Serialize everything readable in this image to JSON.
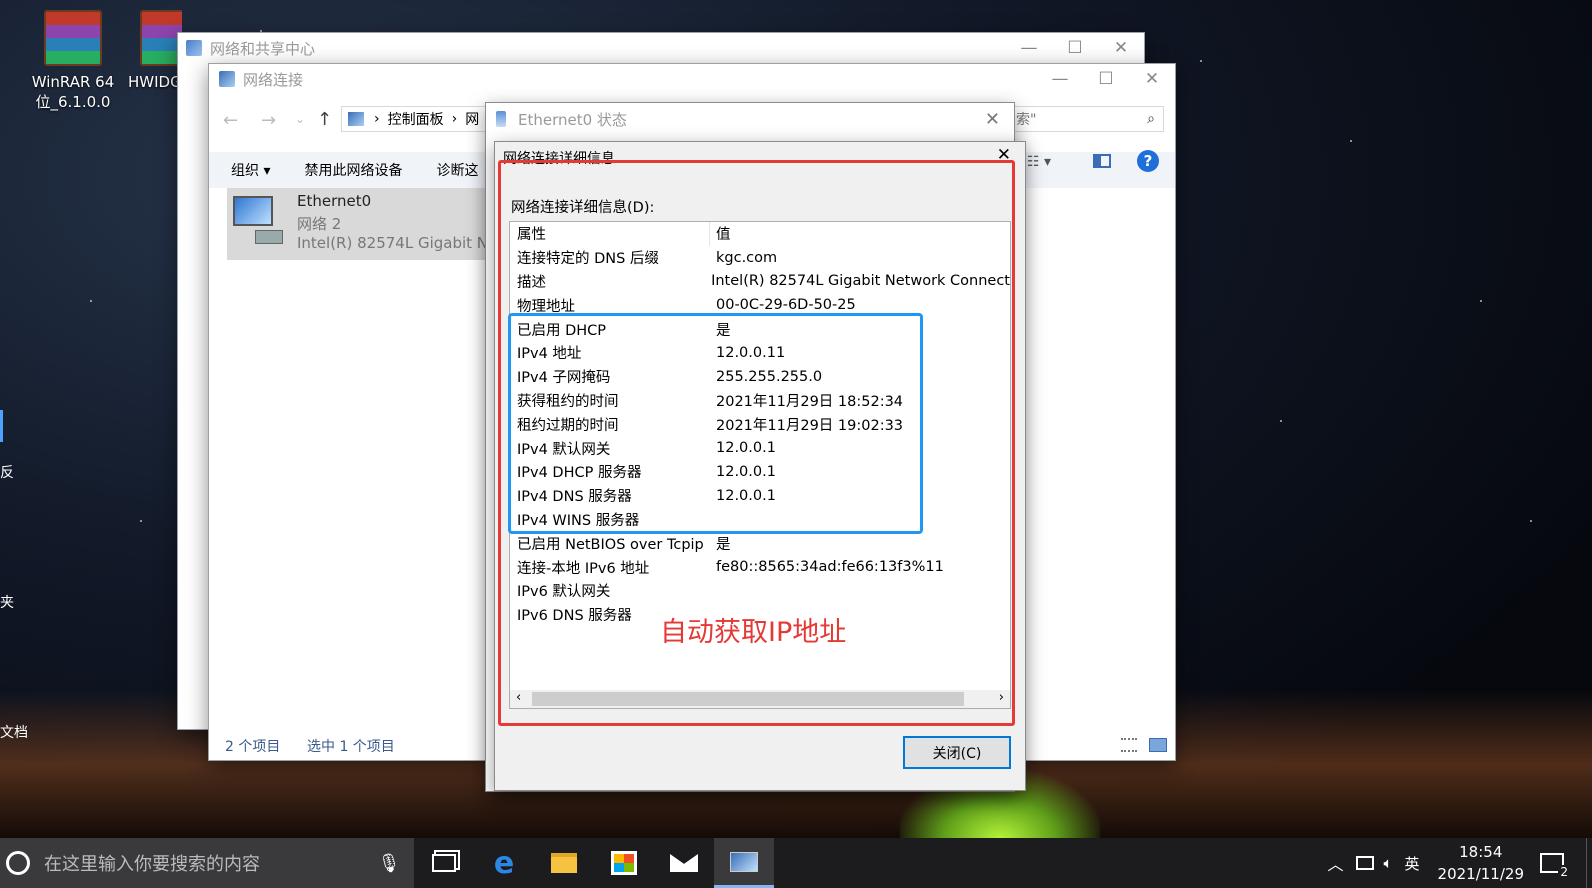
{
  "desktop": {
    "icons": [
      {
        "label_line1": "WinRAR 64",
        "label_line2": "位_6.1.0.0"
      },
      {
        "label_line1": "HWIDG",
        "label_line2": ""
      }
    ],
    "edge_labels": [
      "反",
      "夹",
      "文档"
    ]
  },
  "win_sharing": {
    "title": "网络和共享中心"
  },
  "win_connections": {
    "title": "网络连接",
    "address": {
      "part1": "控制面板",
      "part2": "网"
    },
    "search_text": "索\"",
    "commands": [
      "组织 ▾",
      "禁用此网络设备",
      "诊断这"
    ],
    "item": {
      "name": "Ethernet0",
      "network": "网络  2",
      "adapter": "Intel(R) 82574L Gigabit Ne"
    },
    "status": {
      "count": "2 个项目",
      "selected": "选中 1 个项目"
    }
  },
  "dlg_status": {
    "title": "Ethernet0 状态"
  },
  "dlg_details": {
    "title": "网络连接详细信息",
    "label": "网络连接详细信息(D):",
    "col_property": "属性",
    "col_value": "值",
    "rows": [
      [
        "连接特定的 DNS 后缀",
        "kgc.com"
      ],
      [
        "描述",
        "Intel(R) 82574L Gigabit Network Connect"
      ],
      [
        "物理地址",
        "00-0C-29-6D-50-25"
      ],
      [
        "已启用 DHCP",
        "是"
      ],
      [
        "IPv4 地址",
        "12.0.0.11"
      ],
      [
        "IPv4 子网掩码",
        "255.255.255.0"
      ],
      [
        "获得租约的时间",
        "2021年11月29日 18:52:34"
      ],
      [
        "租约过期的时间",
        "2021年11月29日 19:02:33"
      ],
      [
        "IPv4 默认网关",
        "12.0.0.1"
      ],
      [
        "IPv4 DHCP 服务器",
        "12.0.0.1"
      ],
      [
        "IPv4 DNS 服务器",
        "12.0.0.1"
      ],
      [
        "IPv4 WINS 服务器",
        ""
      ],
      [
        "已启用 NetBIOS over Tcpip",
        "是"
      ],
      [
        "连接-本地 IPv6 地址",
        "fe80::8565:34ad:fe66:13f3%11"
      ],
      [
        "IPv6 默认网关",
        ""
      ],
      [
        "IPv6 DNS 服务器",
        ""
      ]
    ],
    "close_button": "关闭(C)"
  },
  "annotation": {
    "text": "自动获取IP地址",
    "color": "#e53935",
    "box_blue": "#2196f3"
  },
  "taskbar": {
    "search_placeholder": "在这里输入你要搜索的内容",
    "ime": "英",
    "time": "18:54",
    "date": "2021/11/29",
    "notification_count": "2"
  }
}
